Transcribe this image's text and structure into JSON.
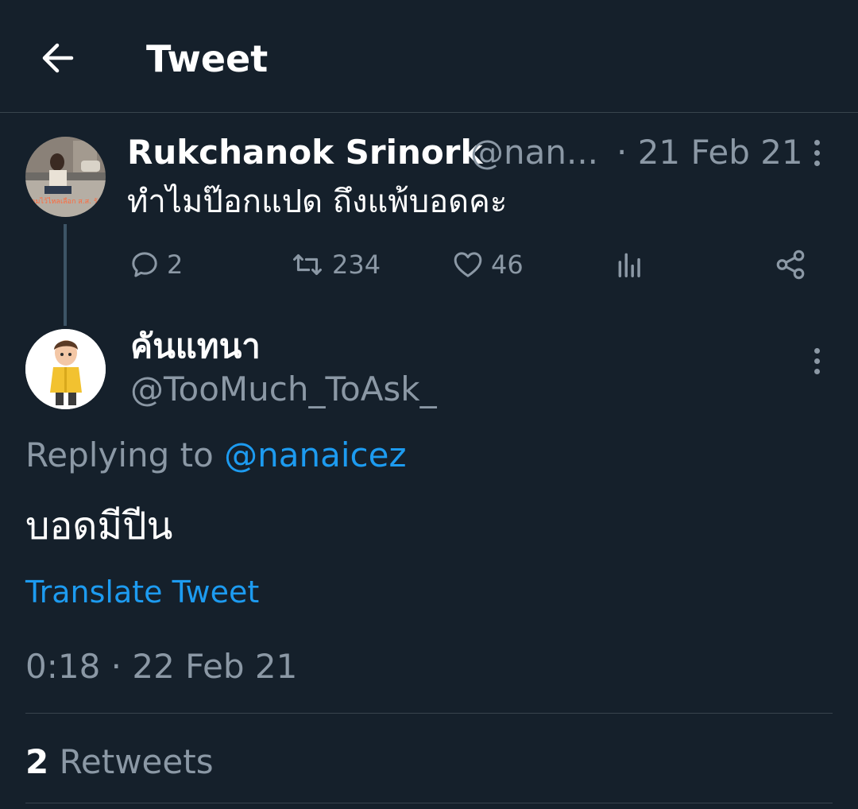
{
  "header": {
    "title": "Tweet"
  },
  "parent_tweet": {
    "display_name": "Rukchanok Srinork",
    "handle": "@nan...",
    "date": "· 21 Feb 21",
    "text": "ทำไมป๊อกแปด ถึงแพ้บอดคะ",
    "stats": {
      "replies": "2",
      "retweets": "234",
      "likes": "46"
    },
    "avatar_caption": "รวมรวมไว้ไหลเลือก ส.ส. รักท่าน"
  },
  "reply_tweet": {
    "display_name": "คันแทนา",
    "handle": "@TooMuch_ToAsk_",
    "replying_prefix": "Replying to",
    "replying_handle": "@nanaicez",
    "text": "บอดมีปีน",
    "translate_label": "Translate Tweet",
    "timestamp": "0:18 · 22 Feb 21",
    "retweet_count": "2",
    "retweet_label": "Retweets"
  },
  "colors": {
    "background": "#15202b",
    "muted": "#8b98a5",
    "accent": "#1d9bf0",
    "divider": "#38444d"
  },
  "icons": [
    "back-arrow-icon",
    "more-vertical-icon",
    "reply-icon",
    "retweet-icon",
    "like-icon",
    "analytics-icon",
    "share-icon"
  ]
}
